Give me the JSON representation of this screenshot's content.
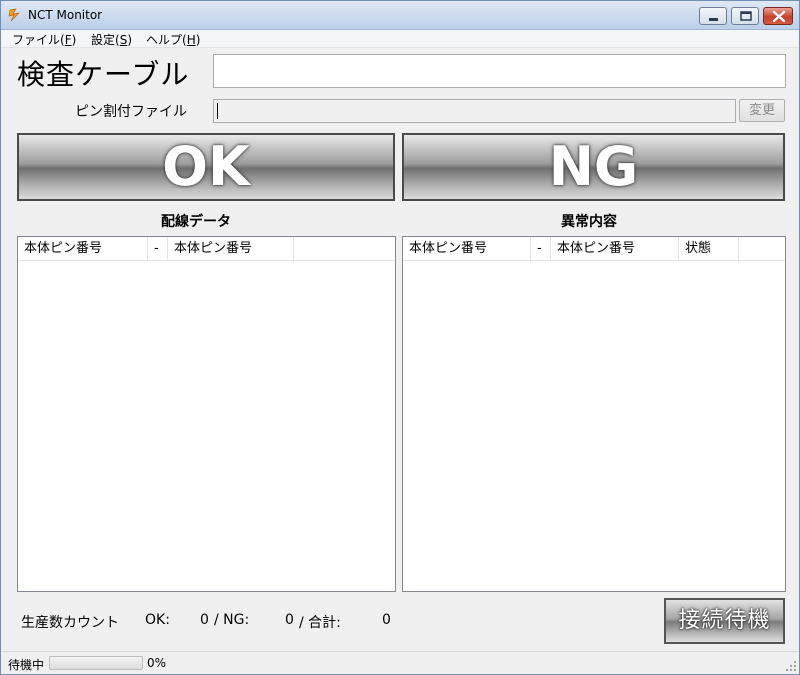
{
  "window": {
    "title": "NCT Monitor",
    "icon": "app-logo-icon"
  },
  "menu": [
    {
      "label": "ファイル(",
      "key": "F",
      "suffix": ")"
    },
    {
      "label": "設定(",
      "key": "S",
      "suffix": ")"
    },
    {
      "label": "ヘルプ(",
      "key": "H",
      "suffix": ")"
    }
  ],
  "cable": {
    "label": "検査ケーブル",
    "value": ""
  },
  "pin_file": {
    "label": "ピン割付ファイル",
    "value": "",
    "change_label": "変更"
  },
  "results": {
    "ok_label": "OK",
    "ng_label": "NG"
  },
  "wiring": {
    "title": "配線データ",
    "columns": [
      "本体ピン番号",
      "-",
      "本体ピン番号"
    ],
    "rows": []
  },
  "errors": {
    "title": "異常内容",
    "columns": [
      "本体ピン番号",
      "-",
      "本体ピン番号",
      "状態"
    ],
    "rows": []
  },
  "counts": {
    "label": "生産数カウント",
    "ok_label": "OK:",
    "ok_value": "0",
    "ng_label": "/ NG:",
    "ng_value": "0",
    "total_label": "/ 合計:",
    "total_value": "0"
  },
  "connect_button": "接続待機",
  "status": {
    "text": "待機中",
    "progress": 0,
    "progress_label": "0%"
  }
}
